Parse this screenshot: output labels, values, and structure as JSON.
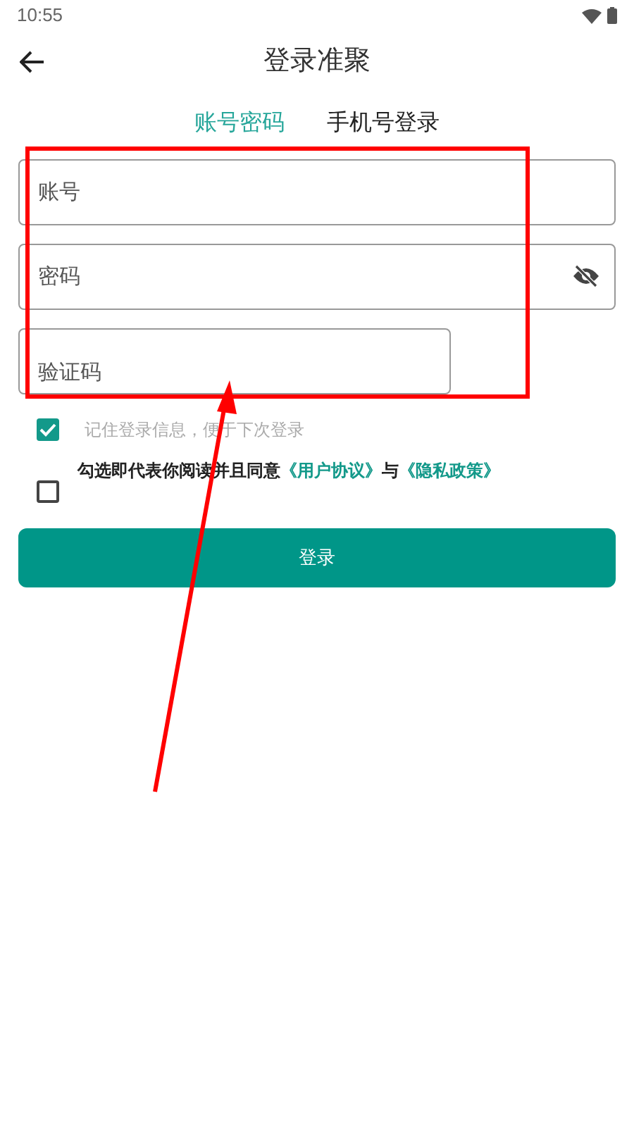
{
  "status_bar": {
    "time": "10:55"
  },
  "header": {
    "title": "登录准聚"
  },
  "tabs": [
    {
      "label": "账号密码",
      "selected": true
    },
    {
      "label": "手机号登录",
      "selected": false
    }
  ],
  "fields": [
    {
      "placeholder": "账号",
      "kind": "wide"
    },
    {
      "placeholder": "密码",
      "kind": "password"
    },
    {
      "placeholder": "验证码",
      "kind": "short"
    }
  ],
  "remember": {
    "label": "记住登录信息，便于下次登录",
    "checked": true
  },
  "agreement": {
    "checked": false,
    "parts": [
      {
        "kind": "text",
        "text": "勾选即代表你阅读并且同意"
      },
      {
        "kind": "link",
        "text": "《用户协议》"
      },
      {
        "kind": "text",
        "text": "与"
      },
      {
        "kind": "link",
        "text": "《隐私政策》"
      }
    ]
  },
  "login_button": {
    "label": "登录"
  }
}
